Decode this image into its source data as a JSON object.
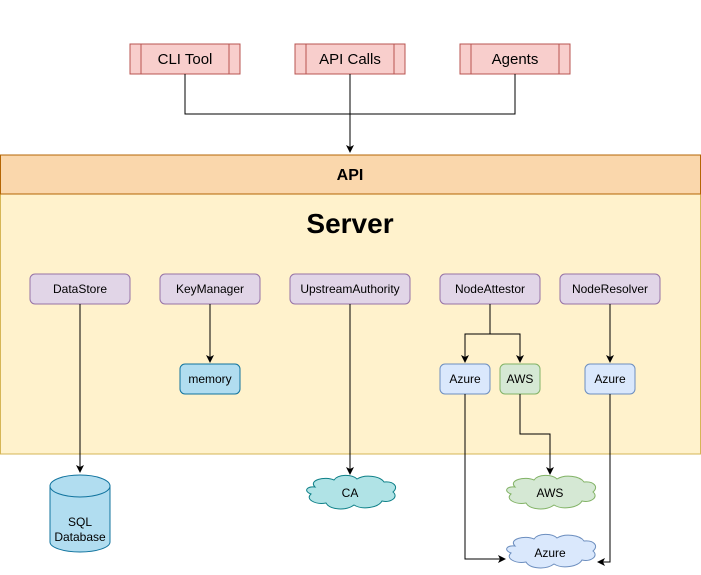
{
  "diagram": {
    "clients": [
      {
        "label": "CLI Tool"
      },
      {
        "label": "API Calls"
      },
      {
        "label": "Agents"
      }
    ],
    "api_bar": {
      "label": "API"
    },
    "server": {
      "title": "Server"
    },
    "plugins": [
      {
        "label": "DataStore"
      },
      {
        "label": "KeyManager"
      },
      {
        "label": "UpstreamAuthority"
      },
      {
        "label": "NodeAttestor"
      },
      {
        "label": "NodeResolver"
      }
    ],
    "implementations": {
      "memory": {
        "label": "memory"
      },
      "attestor_azure": {
        "label": "Azure"
      },
      "attestor_aws": {
        "label": "AWS"
      },
      "resolver_azure": {
        "label": "Azure"
      }
    },
    "external": {
      "database": {
        "line1": "SQL",
        "line2": "Database"
      },
      "ca_cloud": {
        "label": "CA"
      },
      "aws_cloud": {
        "label": "AWS"
      },
      "azure_cloud": {
        "label": "Azure"
      }
    },
    "colors": {
      "client_fill": "#f8cecc",
      "client_stroke": "#b85450",
      "api_fill": "#fad7ac",
      "api_stroke": "#b46504",
      "server_fill": "#fff2cc",
      "server_stroke": "#d6b656",
      "plugin_fill": "#e1d5e7",
      "plugin_stroke": "#9673a6",
      "memory_fill": "#b1ddf0",
      "memory_stroke": "#10739e",
      "azure_fill": "#dae8fc",
      "azure_stroke": "#6c8ebf",
      "aws_fill": "#d5e8d4",
      "aws_stroke": "#82b366",
      "ca_fill": "#b0e3e6",
      "ca_stroke": "#0e8088"
    }
  }
}
